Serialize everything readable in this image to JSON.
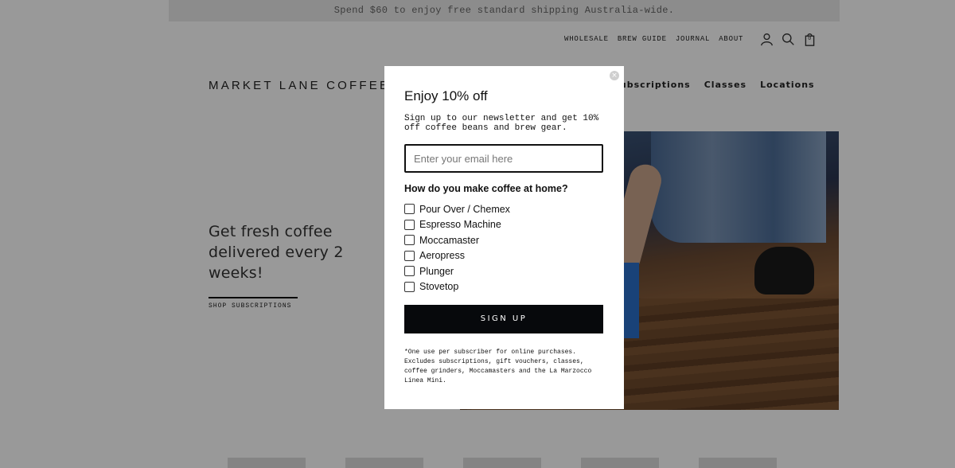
{
  "announcement": "Spend $60 to enjoy free standard shipping Australia-wide.",
  "utility_nav": {
    "links": [
      "WHOLESALE",
      "BREW GUIDE",
      "JOURNAL",
      "ABOUT"
    ],
    "icons": [
      "account-icon",
      "search-icon",
      "cart-icon"
    ],
    "cart_count": "0"
  },
  "logo": "MARKET LANE COFFEE",
  "main_nav": [
    "Subscriptions",
    "Classes",
    "Locations"
  ],
  "hero": {
    "headline": "Get fresh coffee delivered every 2 weeks!",
    "cta": "SHOP SUBSCRIPTIONS"
  },
  "modal": {
    "close": "×",
    "title": "Enjoy 10% off",
    "description": "Sign up to our newsletter and get 10% off coffee beans and brew gear.",
    "email_placeholder": "Enter your email here",
    "question": "How do you make coffee at home?",
    "options": [
      "Pour Over / Chemex",
      "Espresso Machine",
      "Moccamaster",
      "Aeropress",
      "Plunger",
      "Stovetop"
    ],
    "button": "SIGN UP",
    "disclaimer": "*One use per subscriber for online purchases. Excludes subscriptions, gift vouchers, classes, coffee grinders, Moccamasters and the La Marzocco Linea Mini."
  }
}
